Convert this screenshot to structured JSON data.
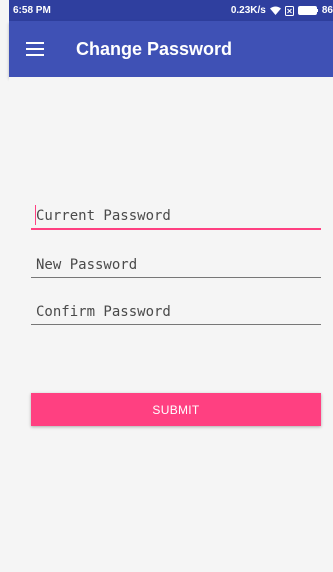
{
  "status_bar": {
    "time": "6:58 PM",
    "network_speed": "0.23K/s",
    "battery": "86",
    "icons": [
      "wifi-icon",
      "sim-icon",
      "battery-icon"
    ]
  },
  "toolbar": {
    "menu_icon": "hamburger-menu-icon",
    "title": "Change Password"
  },
  "form": {
    "current_password": {
      "value": "",
      "placeholder": "Current Password",
      "focused": true
    },
    "new_password": {
      "value": "",
      "placeholder": "New Password"
    },
    "confirm_password": {
      "value": "",
      "placeholder": "Confirm Password"
    },
    "submit_label": "SUBMIT"
  },
  "colors": {
    "primary": "#3f51b5",
    "status_bar": "#2f3f9f",
    "accent": "#ff4081",
    "background": "#f5f5f5"
  }
}
